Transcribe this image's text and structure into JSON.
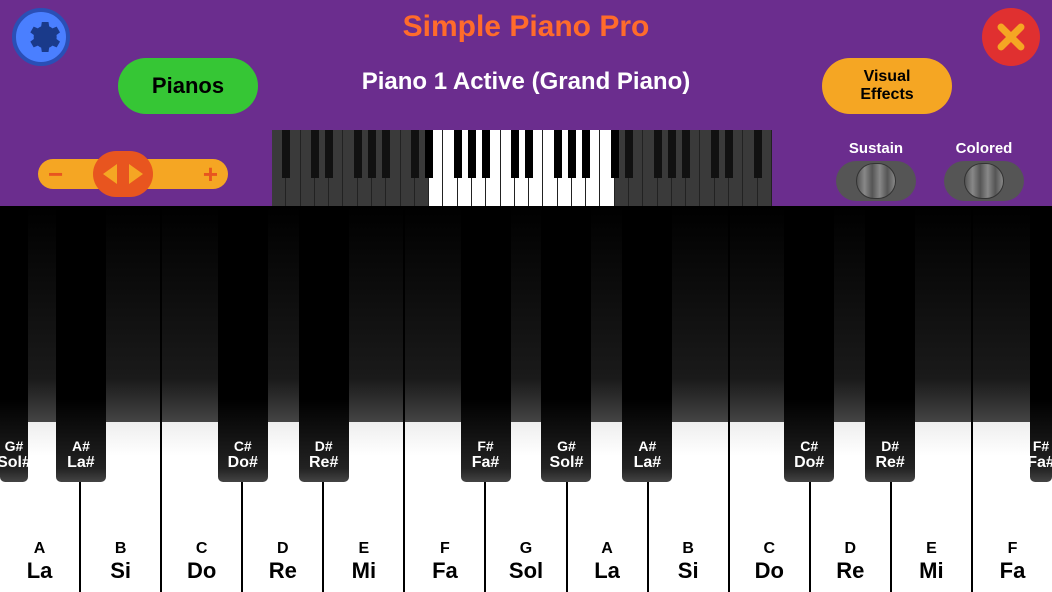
{
  "app": {
    "title": "Simple Piano Pro",
    "status": "Piano 1 Active (Grand Piano)"
  },
  "buttons": {
    "pianos": "Pianos",
    "visual_fx_line1": "Visual",
    "visual_fx_line2": "Effects"
  },
  "toggles": {
    "sustain": {
      "label": "Sustain",
      "on": false
    },
    "colored": {
      "label": "Colored",
      "on": false
    }
  },
  "icons": {
    "settings": "gear-icon",
    "close": "close-icon"
  },
  "zoom": {
    "minus": "−",
    "plus": "+"
  },
  "mini_keyboard": {
    "total_white_keys": 35,
    "active_range_start": 11,
    "active_range_end": 23
  },
  "keyboard": {
    "white_keys": [
      {
        "note": "A",
        "solfege": "La"
      },
      {
        "note": "B",
        "solfege": "Si"
      },
      {
        "note": "C",
        "solfege": "Do"
      },
      {
        "note": "D",
        "solfege": "Re"
      },
      {
        "note": "E",
        "solfege": "Mi"
      },
      {
        "note": "F",
        "solfege": "Fa"
      },
      {
        "note": "G",
        "solfege": "Sol"
      },
      {
        "note": "A",
        "solfege": "La"
      },
      {
        "note": "B",
        "solfege": "Si"
      },
      {
        "note": "C",
        "solfege": "Do"
      },
      {
        "note": "D",
        "solfege": "Re"
      },
      {
        "note": "E",
        "solfege": "Mi"
      },
      {
        "note": "F",
        "solfege": "Fa"
      }
    ],
    "black_keys": [
      {
        "after_white_index": 0,
        "note": "G#",
        "solfege": "Sol#",
        "partial": "left"
      },
      {
        "after_white_index": 1,
        "note": "A#",
        "solfege": "La#"
      },
      {
        "after_white_index": 3,
        "note": "C#",
        "solfege": "Do#"
      },
      {
        "after_white_index": 4,
        "note": "D#",
        "solfege": "Re#"
      },
      {
        "after_white_index": 6,
        "note": "F#",
        "solfege": "Fa#"
      },
      {
        "after_white_index": 7,
        "note": "G#",
        "solfege": "Sol#"
      },
      {
        "after_white_index": 8,
        "note": "A#",
        "solfege": "La#"
      },
      {
        "after_white_index": 10,
        "note": "C#",
        "solfege": "Do#"
      },
      {
        "after_white_index": 11,
        "note": "D#",
        "solfege": "Re#"
      },
      {
        "after_white_index": 13,
        "note": "F#",
        "solfege": "Fa#",
        "partial": "right"
      }
    ]
  }
}
